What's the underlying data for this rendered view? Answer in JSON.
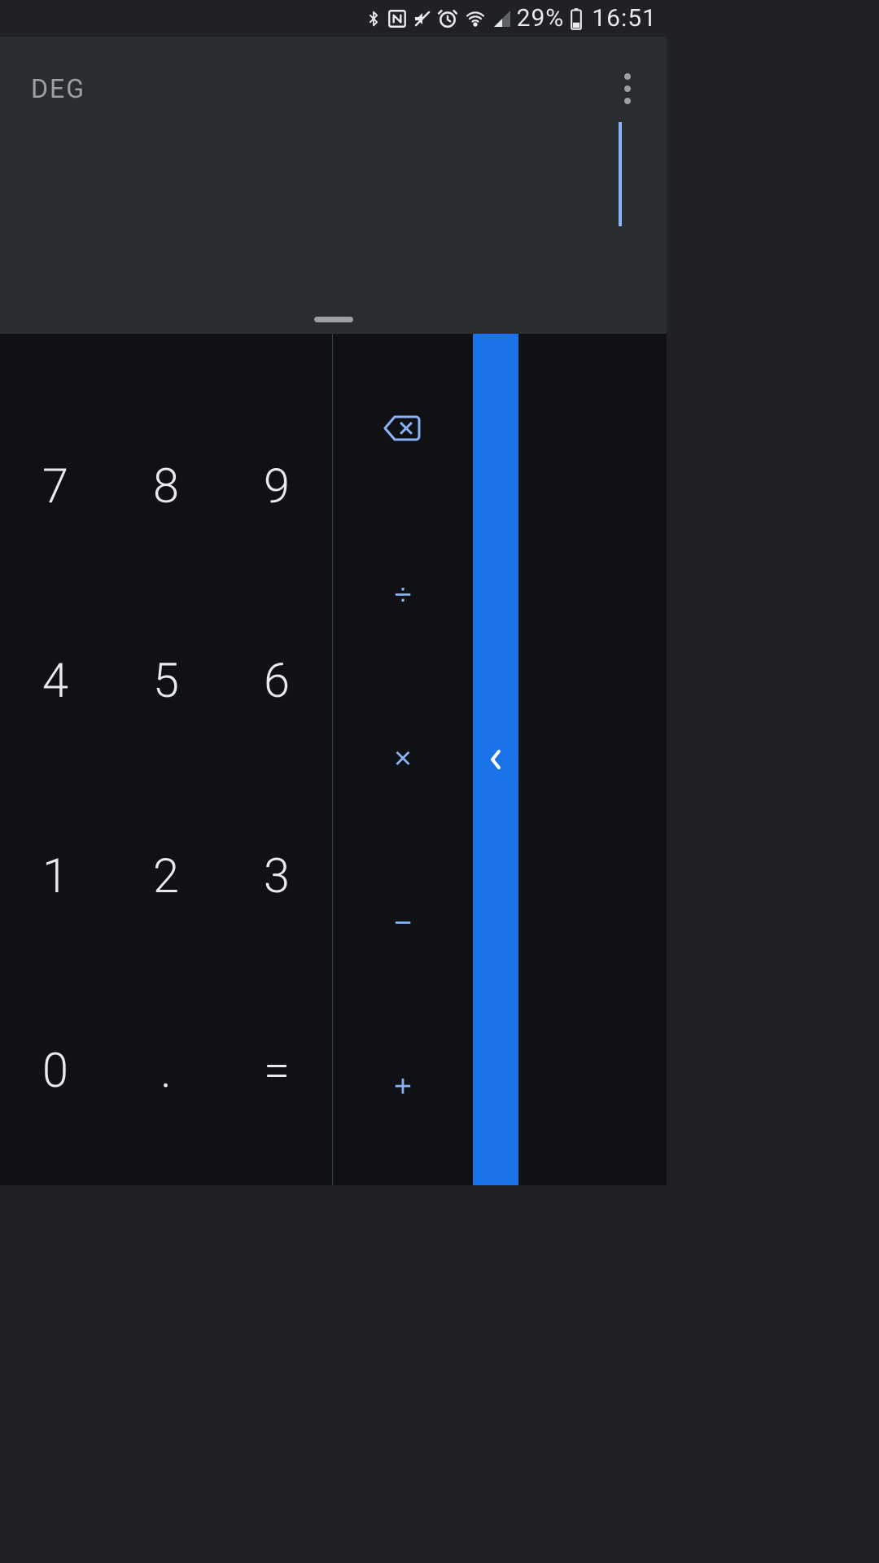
{
  "status_bar": {
    "battery_percent": "29%",
    "time": "16:51"
  },
  "display": {
    "mode": "DEG",
    "input_value": ""
  },
  "numpad": {
    "r0c0": "7",
    "r0c1": "8",
    "r0c2": "9",
    "r1c0": "4",
    "r1c1": "5",
    "r1c2": "6",
    "r2c0": "1",
    "r2c1": "2",
    "r2c2": "3",
    "r3c0": "0",
    "r3c1": ".",
    "r3c2": "="
  },
  "operators": {
    "delete": "⌫",
    "divide": "÷",
    "multiply": "×",
    "minus": "−",
    "plus": "+"
  },
  "advanced_panel": {
    "expand_label": "‹"
  }
}
